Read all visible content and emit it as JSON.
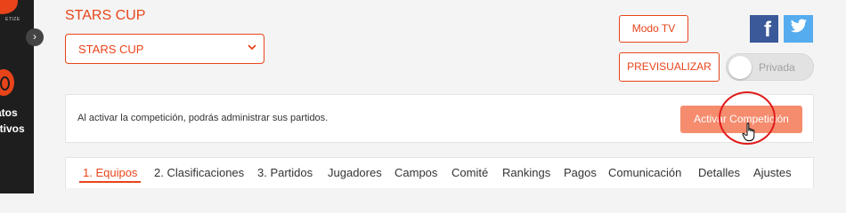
{
  "sidebar": {
    "brand_text": "ETIZE",
    "nav_label_line1": "atos",
    "nav_label_line2": "rtivos",
    "collapse_symbol": "›"
  },
  "header": {
    "title": "STARS CUP",
    "competition_select": {
      "selected": "STARS CUP",
      "chevron": "⌄"
    }
  },
  "actions": {
    "modo_tv": "Modo TV",
    "previsualizar": "PREVISUALIZAR",
    "privada_toggle": {
      "label": "Privada",
      "on": false
    },
    "social": {
      "facebook": "f",
      "twitter": "🐦"
    }
  },
  "notice": {
    "message": "Al activar la competición, podrás administrar sus partidos.",
    "activate_button": "Activar Competición"
  },
  "tabs": [
    {
      "label": "1. Equipos",
      "active": true
    },
    {
      "label": "2. Clasificaciones",
      "active": false
    },
    {
      "label": "3. Partidos",
      "active": false
    },
    {
      "label": "Jugadores",
      "active": false
    },
    {
      "label": "Campos",
      "active": false
    },
    {
      "label": "Comité",
      "active": false
    },
    {
      "label": "Rankings",
      "active": false
    },
    {
      "label": "Pagos",
      "active": false
    },
    {
      "label": "Comunicación",
      "active": false
    },
    {
      "label": "Detalles",
      "active": false
    },
    {
      "label": "Ajustes",
      "active": false
    }
  ],
  "colors": {
    "accent": "#e8441a",
    "activate_button": "#f58c6e",
    "sidebar": "#1e1e1e",
    "facebook": "#3b5998",
    "twitter": "#55acee"
  },
  "icons": [
    "brand-logo-icon",
    "sport-nav-icon",
    "chevron-right-icon",
    "chevron-down-icon",
    "facebook-icon",
    "twitter-icon",
    "hand-pointer-cursor-icon"
  ]
}
